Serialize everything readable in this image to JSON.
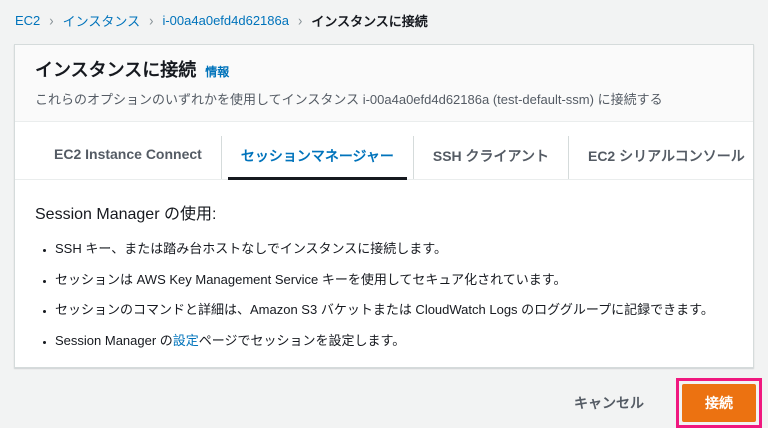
{
  "colors": {
    "page_background": "#f2f3f3",
    "panel_background": "#ffffff",
    "panel_header_background": "#fafafa",
    "link_blue": "#0073bb",
    "text_dark": "#16191f",
    "text_gray": "#545b64",
    "primary_button_orange": "#ec7211",
    "active_tab_underline": "#16191f",
    "annotation_pink": "#f0187f"
  },
  "breadcrumb": {
    "separator": "›",
    "items": [
      {
        "label": "EC2"
      },
      {
        "label": "インスタンス"
      },
      {
        "label": "i-00a4a0efd4d62186a"
      },
      {
        "label": "インスタンスに接続"
      }
    ]
  },
  "panel": {
    "title": "インスタンスに接続",
    "info_label": "情報",
    "description": "これらのオプションのいずれかを使用してインスタンス i-00a4a0efd4d62186a (test-default-ssm) に接続する"
  },
  "tabs": [
    {
      "label": "EC2 Instance Connect",
      "active": false
    },
    {
      "label": "セッションマネージャー",
      "active": true
    },
    {
      "label": "SSH クライアント",
      "active": false
    },
    {
      "label": "EC2 シリアルコンソール",
      "active": false
    }
  ],
  "content": {
    "heading": "Session Manager の使用:",
    "bullets": [
      {
        "text": "SSH キー、または踏み台ホストなしでインスタンスに接続します。"
      },
      {
        "text": "セッションは AWS Key Management Service キーを使用してセキュア化されています。"
      },
      {
        "text": "セッションのコマンドと詳細は、Amazon S3 バケットまたは CloudWatch Logs のロググループに記録できます。"
      },
      {
        "pre": "Session Manager の",
        "link_text": "設定",
        "post": "ページでセッションを設定します。"
      }
    ]
  },
  "footer": {
    "cancel_label": "キャンセル",
    "connect_label": "接続"
  }
}
